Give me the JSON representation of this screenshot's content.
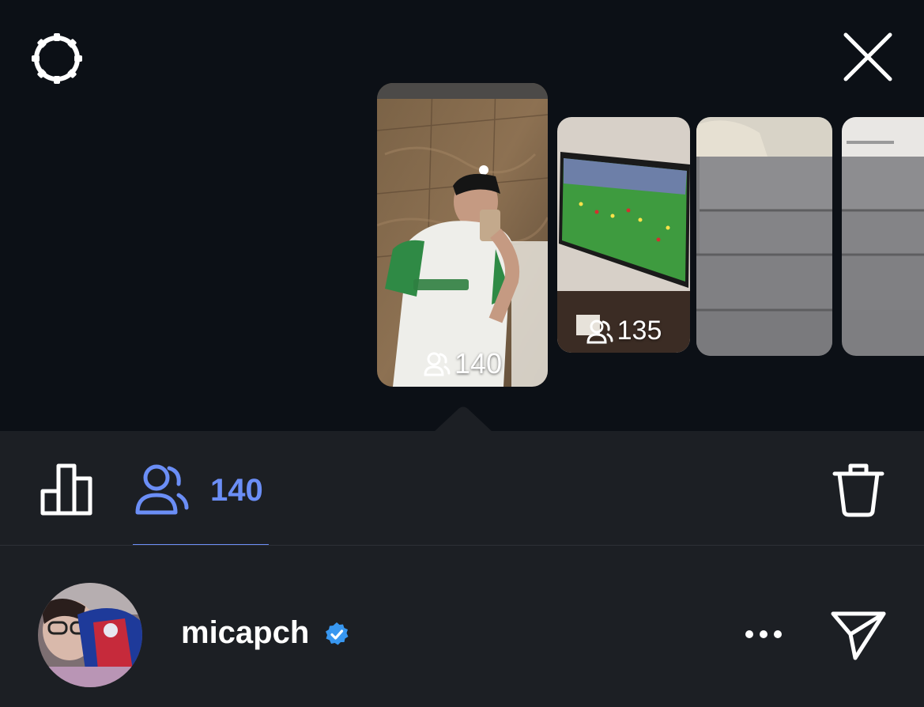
{
  "top": {
    "settings_icon": "gear-icon",
    "close_icon": "close-icon"
  },
  "stories": [
    {
      "viewers": "140",
      "selected": true,
      "icon": "viewers-icon"
    },
    {
      "viewers": "135",
      "selected": false,
      "icon": "viewers-icon"
    },
    {
      "viewers": "",
      "selected": false
    },
    {
      "viewers": "",
      "selected": false
    }
  ],
  "toolbar": {
    "insights_icon": "bar-chart-icon",
    "viewers_icon": "viewers-icon",
    "viewers_count": "140",
    "delete_icon": "trash-icon"
  },
  "viewer_list": [
    {
      "username": "micapch",
      "verified": true
    }
  ],
  "colors": {
    "background": "#0c1016",
    "sheet": "#1c1f24",
    "accent": "#6b8ef6",
    "verified_badge": "#3897f0"
  }
}
